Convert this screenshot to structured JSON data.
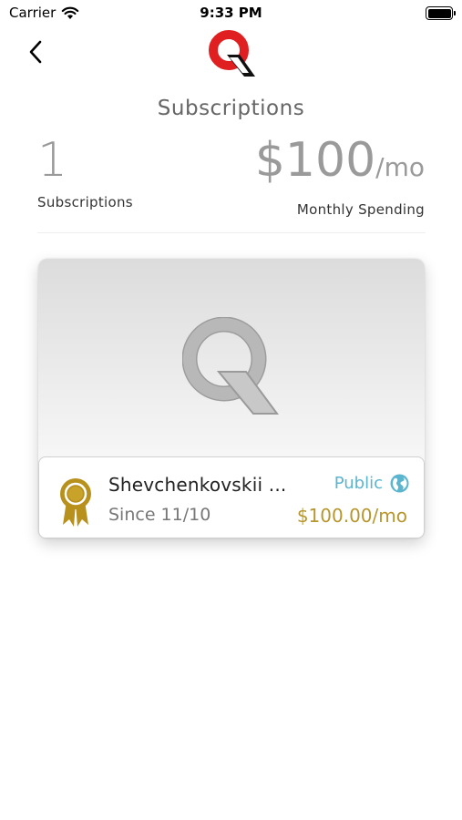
{
  "status_bar": {
    "carrier": "Carrier",
    "time": "9:33 PM"
  },
  "header": {
    "title": "Subscriptions"
  },
  "stats": {
    "count": "1",
    "count_label": "Subscriptions",
    "spending_amount": "$100",
    "spending_unit": "/mo",
    "spending_label": "Monthly Spending"
  },
  "subscriptions": [
    {
      "creator_name": "Shevchenkovskii ...",
      "since": "Since 11/10",
      "visibility": "Public",
      "price": "$100.00/mo"
    }
  ],
  "icons": {
    "back": "chevron-left-icon",
    "logo": "q-logo-icon",
    "badge": "ribbon-award-icon",
    "visibility": "globe-icon",
    "wifi": "wifi-icon",
    "battery": "battery-icon"
  },
  "colors": {
    "brand_red": "#e02020",
    "accent_blue": "#5bb5cf",
    "price_gold": "#b8962e",
    "badge_gold": "#b8901c"
  }
}
